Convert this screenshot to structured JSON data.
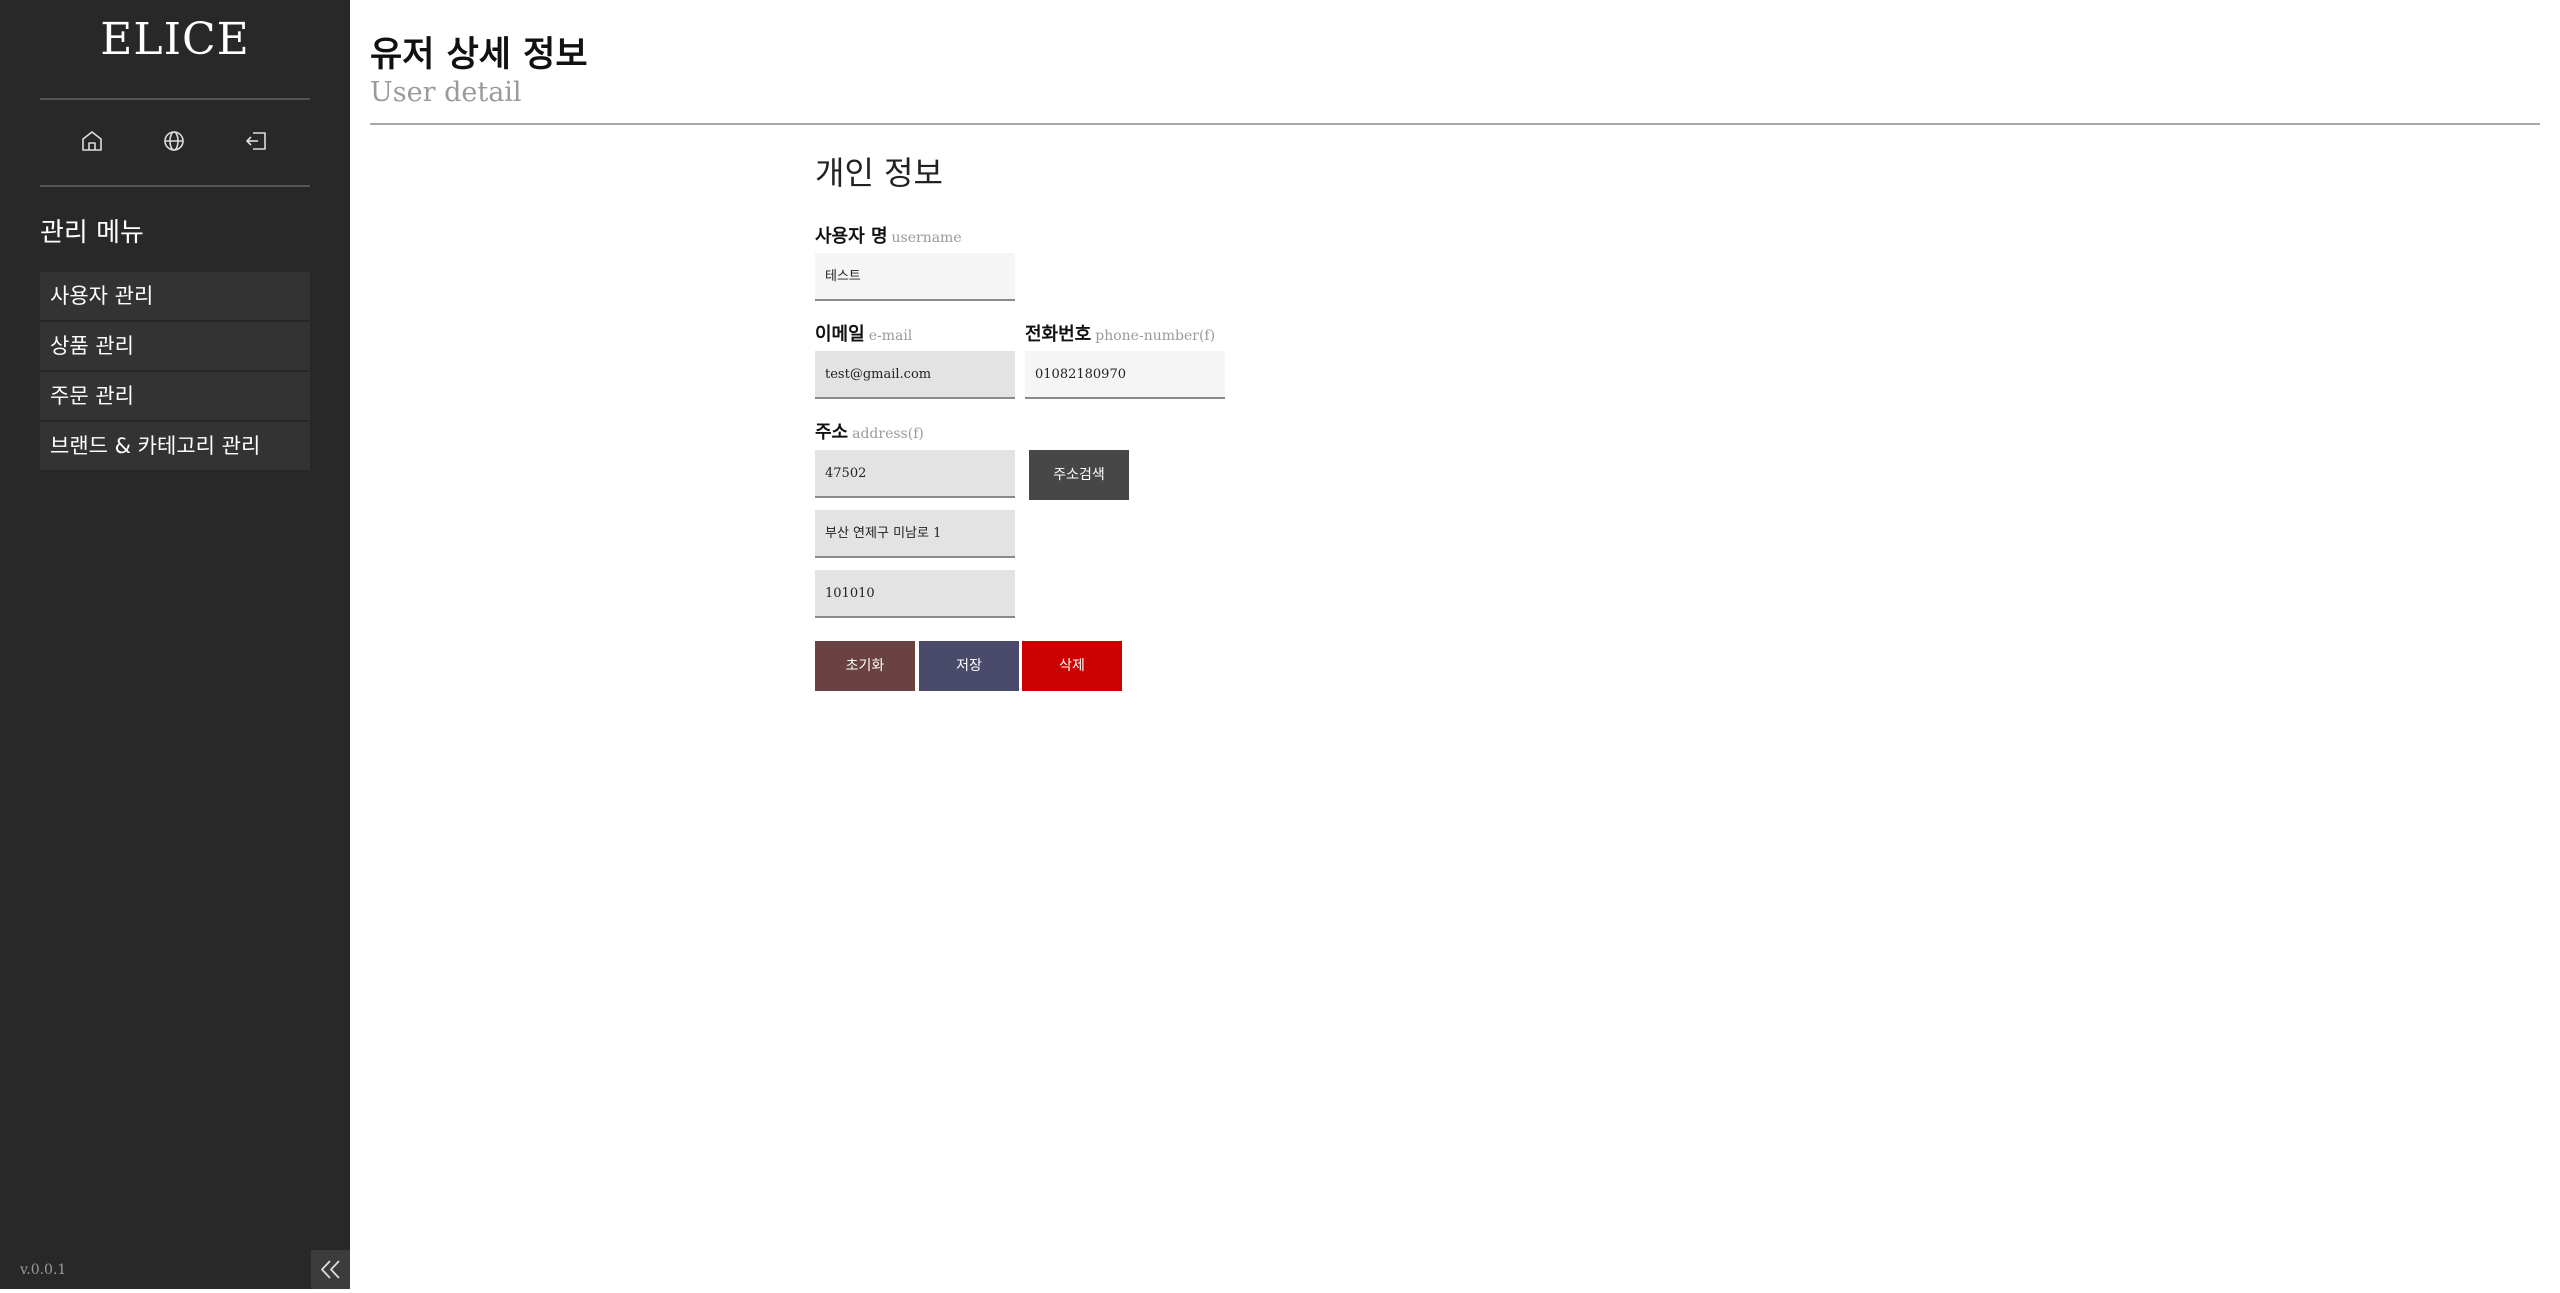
{
  "sidebar": {
    "logo": "ELICE",
    "icons": [
      "home-icon",
      "globe-icon",
      "logout-icon"
    ],
    "menu_title": "관리 메뉴",
    "items": [
      {
        "label": "사용자 관리"
      },
      {
        "label": "상품 관리"
      },
      {
        "label": "주문 관리"
      },
      {
        "label": "브랜드 & 카테고리 관리"
      }
    ],
    "version": "v.0.0.1"
  },
  "header": {
    "title": "유저 상세 정보",
    "subtitle": "User detail"
  },
  "form": {
    "section_title": "개인 정보",
    "username": {
      "label": "사용자 명",
      "hint": "username",
      "value": "테스트"
    },
    "email": {
      "label": "이메일",
      "hint": "e-mail",
      "value": "test@gmail.com"
    },
    "phone": {
      "label": "전화번호",
      "hint": "phone-number(f)",
      "value": "01082180970"
    },
    "address": {
      "label": "주소",
      "hint": "address(f)",
      "postcode": "47502",
      "line1": "부산 연제구 미남로 1",
      "line2": "101010",
      "search_button": "주소검색"
    },
    "buttons": {
      "reset": "초기화",
      "save": "저장",
      "delete": "삭제"
    }
  },
  "colors": {
    "sidebar_bg": "#282828",
    "reset_button": "#6b4242",
    "save_button": "#4a4a6a",
    "delete_button": "#cc0000",
    "search_button": "#474747"
  }
}
